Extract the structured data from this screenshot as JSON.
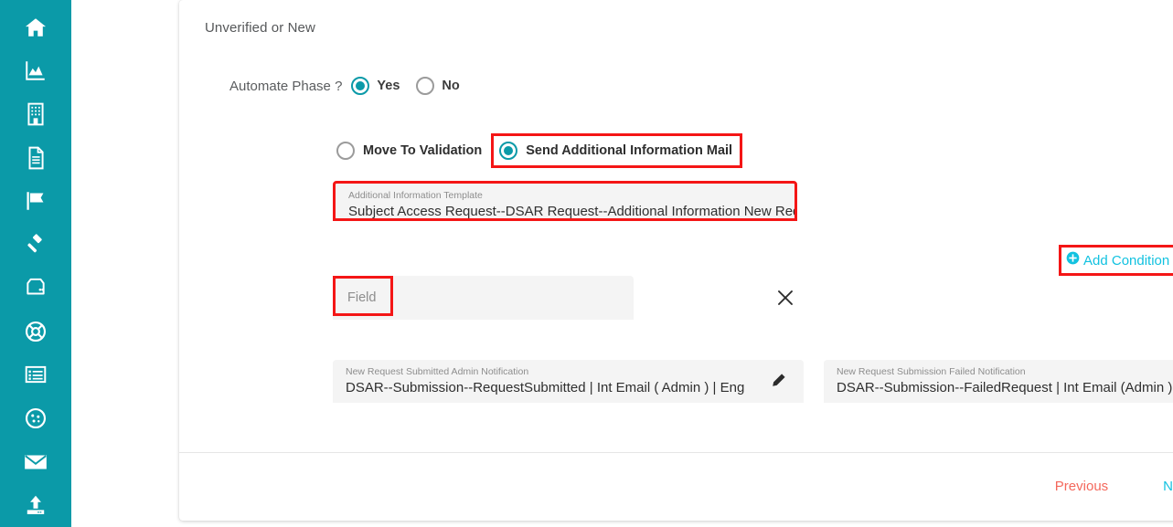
{
  "colors": {
    "sidebar_teal": "#0b9aa8",
    "accent_cyan": "#12c2e0",
    "annotation_red": "#f41616",
    "previous_salmon": "#f4685c",
    "field_gray": "#f4f4f4"
  },
  "sidebar": {
    "items": [
      {
        "icon": "home-icon",
        "name": "sidebar-item-home"
      },
      {
        "icon": "chart-area-icon",
        "name": "sidebar-item-analytics"
      },
      {
        "icon": "building-icon",
        "name": "sidebar-item-organization"
      },
      {
        "icon": "document-icon",
        "name": "sidebar-item-documents"
      },
      {
        "icon": "flag-icon",
        "name": "sidebar-item-flags"
      },
      {
        "icon": "gavel-icon",
        "name": "sidebar-item-legal"
      },
      {
        "icon": "server-icon",
        "name": "sidebar-item-server"
      },
      {
        "icon": "lifebuoy-icon",
        "name": "sidebar-item-support"
      },
      {
        "icon": "list-view-icon",
        "name": "sidebar-item-records"
      },
      {
        "icon": "cookie-icon",
        "name": "sidebar-item-cookies"
      },
      {
        "icon": "envelope-icon",
        "name": "sidebar-item-mail"
      },
      {
        "icon": "upload-icon",
        "name": "sidebar-item-upload"
      }
    ]
  },
  "phase": {
    "title": "Unverified or New",
    "automate": {
      "label": "Automate Phase ?",
      "options": [
        {
          "label": "Yes",
          "selected": true
        },
        {
          "label": "No",
          "selected": false
        }
      ]
    },
    "actions": [
      {
        "label": "Move To Validation",
        "selected": false,
        "highlighted": false
      },
      {
        "label": "Send Additional Information Mail",
        "selected": true,
        "highlighted": true
      }
    ],
    "template_field": {
      "label": "Additional Information Template",
      "value": "Subject Access Request--DSAR Request--Additional Information New Reques",
      "highlighted": true
    },
    "add_condition": {
      "label": "Add Condition",
      "icon": "plus-circle-icon",
      "highlighted": true
    },
    "condition_row": {
      "field_placeholder": "Field",
      "field_highlighted": true,
      "remove_icon": "close-icon"
    },
    "notifications": [
      {
        "label": "New Request Submitted Admin Notification",
        "value": "DSAR--Submission--RequestSubmitted | Int Email ( Admin ) | Eng",
        "edit_icon": "pencil-icon"
      },
      {
        "label": "New Request Submission Failed Notification",
        "value": "DSAR--Submission--FailedRequest | Int Email (Admin ) | Eng",
        "edit_icon": "pencil-icon"
      }
    ]
  },
  "footer": {
    "previous_label": "Previous",
    "next_label": "Next"
  }
}
